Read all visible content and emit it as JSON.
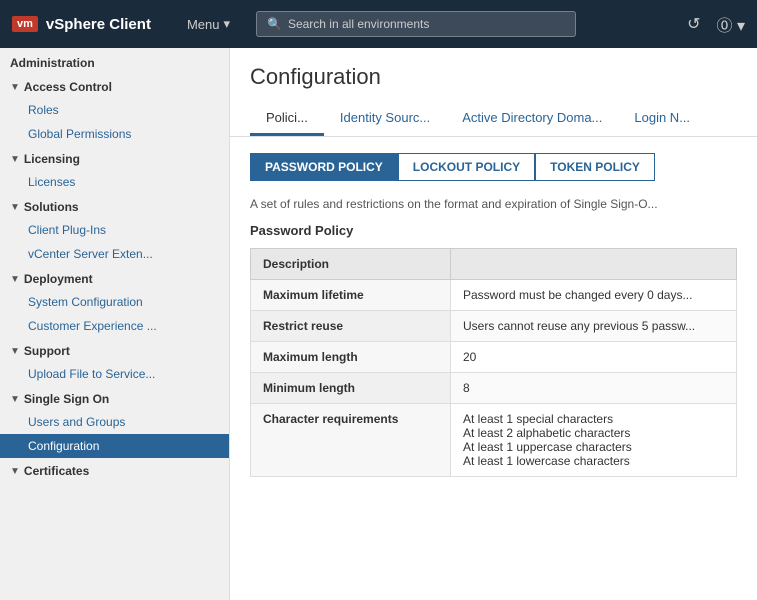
{
  "topnav": {
    "logo_badge": "vm",
    "app_name": "vSphere Client",
    "menu_label": "Menu",
    "search_placeholder": "Search in all environments",
    "refresh_icon": "↺",
    "help_icon": "?"
  },
  "sidebar": {
    "administration_label": "Administration",
    "sections": [
      {
        "id": "access-control",
        "label": "Access Control",
        "expanded": true,
        "items": [
          "Roles",
          "Global Permissions"
        ]
      },
      {
        "id": "licensing",
        "label": "Licensing",
        "expanded": true,
        "items": [
          "Licenses"
        ]
      },
      {
        "id": "solutions",
        "label": "Solutions",
        "expanded": true,
        "items": [
          "Client Plug-Ins",
          "vCenter Server Exten..."
        ]
      },
      {
        "id": "deployment",
        "label": "Deployment",
        "expanded": true,
        "items": [
          "System Configuration",
          "Customer Experience ..."
        ]
      },
      {
        "id": "support",
        "label": "Support",
        "expanded": true,
        "items": [
          "Upload File to Service..."
        ]
      },
      {
        "id": "single-sign-on",
        "label": "Single Sign On",
        "expanded": true,
        "items": [
          "Users and Groups",
          "Configuration"
        ]
      },
      {
        "id": "certificates",
        "label": "Certificates",
        "expanded": true,
        "items": []
      }
    ]
  },
  "content": {
    "title": "Configuration",
    "tabs": [
      {
        "id": "policies",
        "label": "Polici...",
        "active": true
      },
      {
        "id": "identity-sources",
        "label": "Identity Sourc..."
      },
      {
        "id": "active-directory",
        "label": "Active Directory Doma..."
      },
      {
        "id": "login",
        "label": "Login N..."
      }
    ],
    "policy_buttons": [
      {
        "id": "password",
        "label": "PASSWORD POLICY",
        "active": true
      },
      {
        "id": "lockout",
        "label": "LOCKOUT POLICY"
      },
      {
        "id": "token",
        "label": "TOKEN POLICY"
      }
    ],
    "description": "A set of rules and restrictions on the format and expiration of Single Sign-O...",
    "section_title": "Password Policy",
    "table_header": "Description",
    "table_rows": [
      {
        "label": "Maximum lifetime",
        "value": "Password must be changed every 0 days..."
      },
      {
        "label": "Restrict reuse",
        "value": "Users cannot reuse any previous 5 passw..."
      },
      {
        "label": "Maximum length",
        "value": "20"
      },
      {
        "label": "Minimum length",
        "value": "8"
      },
      {
        "label": "Character requirements",
        "value_lines": [
          "At least 1 special characters",
          "At least 2 alphabetic characters",
          "At least 1 uppercase characters",
          "At least 1 lowercase characters"
        ]
      }
    ]
  }
}
